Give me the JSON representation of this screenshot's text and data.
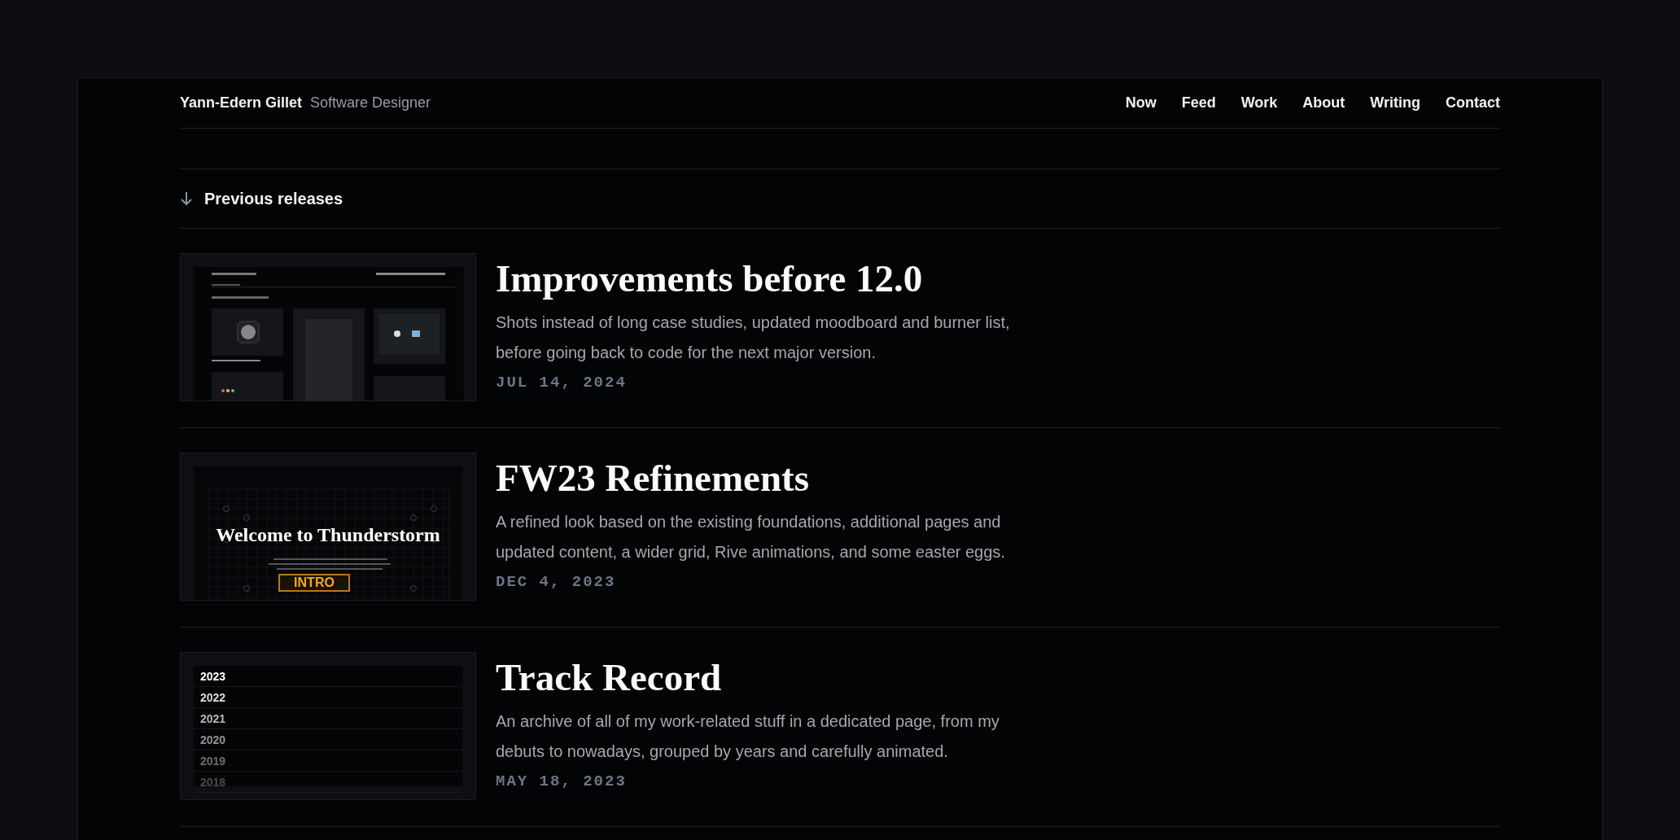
{
  "site": {
    "name": "Yann-Edern Gillet",
    "role": "Software Designer"
  },
  "nav": [
    {
      "label": "Now"
    },
    {
      "label": "Feed"
    },
    {
      "label": "Work"
    },
    {
      "label": "About"
    },
    {
      "label": "Writing"
    },
    {
      "label": "Contact"
    }
  ],
  "section_heading": "Previous releases",
  "releases": [
    {
      "title": "Improvements before 12.0",
      "description": "Shots instead of long case studies, updated moodboard and burner list, before going back to code for the next major version.",
      "date": "JUL 14, 2024",
      "thumbnail": {
        "kind": "shots"
      }
    },
    {
      "title": "FW23 Refinements",
      "description": "A refined look based on the existing foundations, additional pages and updated content, a wider grid, Rive animations, and some easter eggs.",
      "date": "DEC 4, 2023",
      "thumbnail": {
        "kind": "hero",
        "headline": "Welcome to Thunderstorm",
        "badge": "INTRO"
      }
    },
    {
      "title": "Track Record",
      "description": "An archive of all of my work-related stuff in a dedicated page, from my debuts to nowadays, grouped by years and carefully animated.",
      "date": "MAY 18, 2023",
      "thumbnail": {
        "kind": "years",
        "years": [
          "2023",
          "2022",
          "2021",
          "2020",
          "2019",
          "2018"
        ]
      }
    }
  ]
}
